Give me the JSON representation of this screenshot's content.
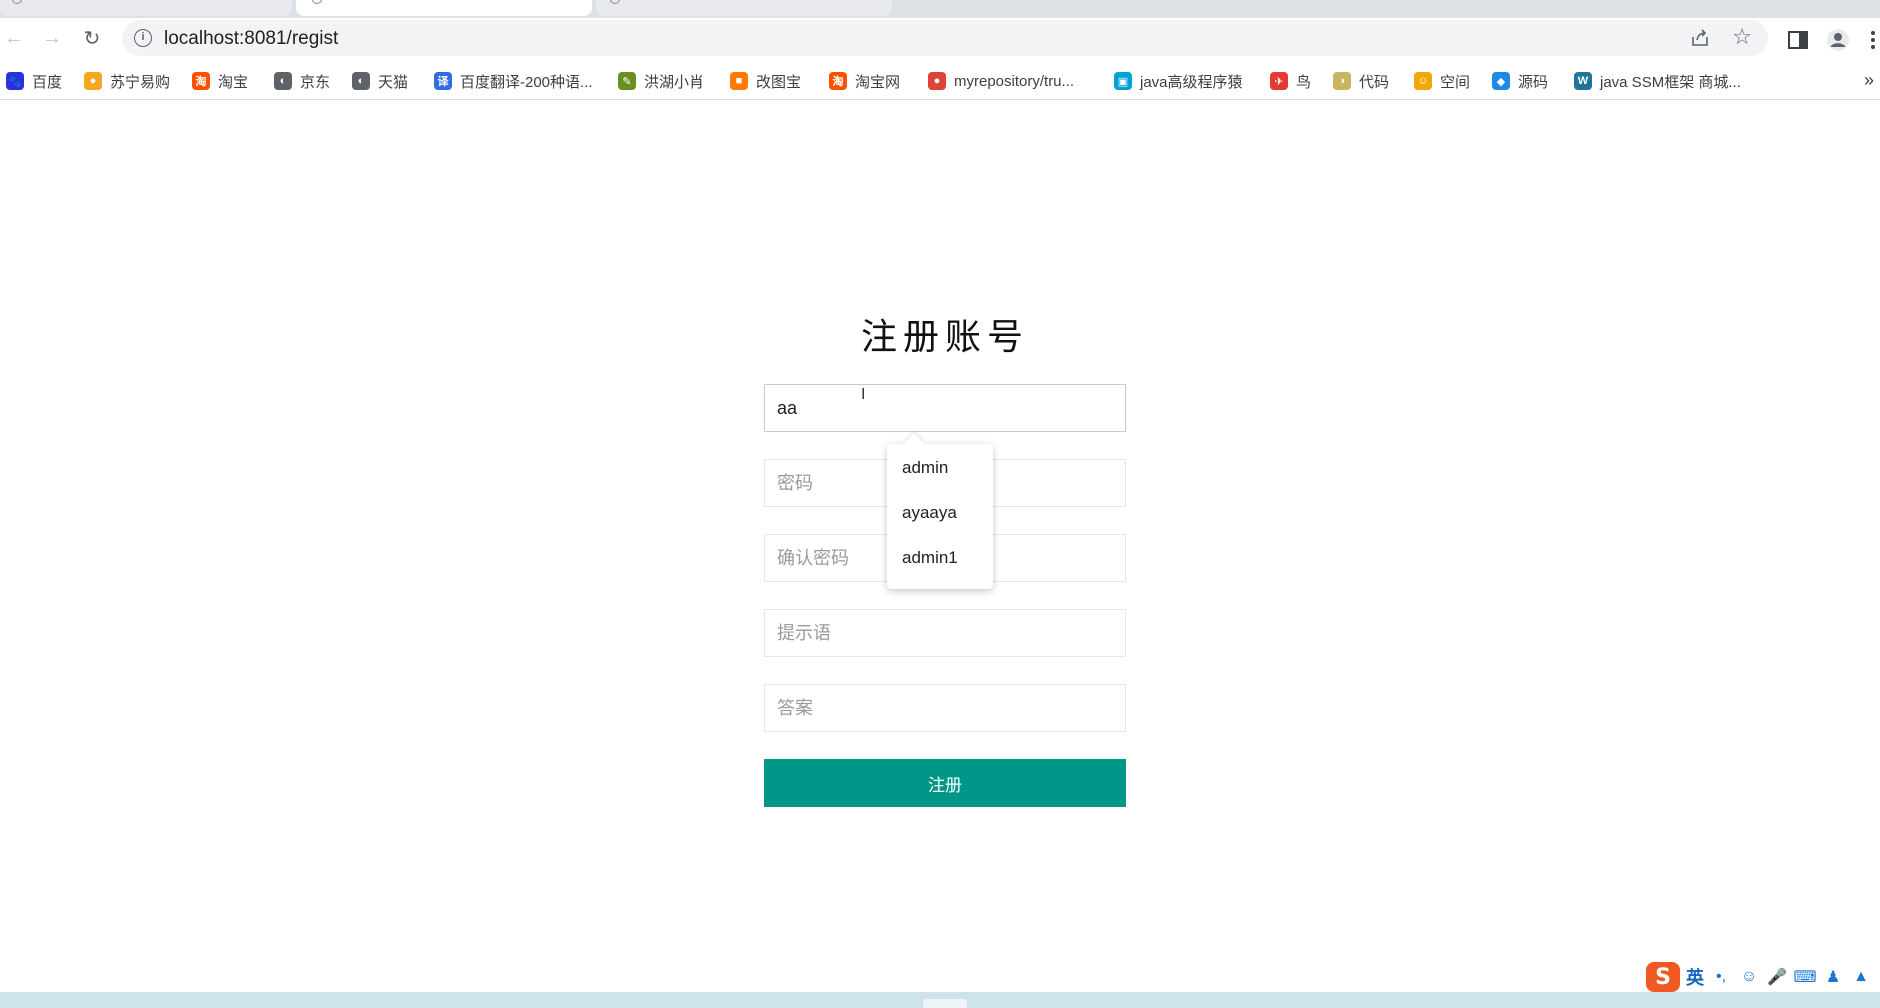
{
  "browser": {
    "url": "localhost:8081/regist",
    "info_icon": "i"
  },
  "bookmarks": [
    {
      "label": "百度",
      "icon": "baidu-icon",
      "color": "#2932e1",
      "glyph": "🐾"
    },
    {
      "label": "苏宁易购",
      "icon": "suning-icon",
      "color": "#f5a623",
      "glyph": "●"
    },
    {
      "label": "淘宝",
      "icon": "taobao-icon",
      "color": "#ff5000",
      "glyph": "淘"
    },
    {
      "label": "京东",
      "icon": "globe-icon",
      "color": "#5f6368",
      "glyph": "◐"
    },
    {
      "label": "天猫",
      "icon": "globe-icon",
      "color": "#5f6368",
      "glyph": "◐"
    },
    {
      "label": "百度翻译-200种语...",
      "icon": "translate-icon",
      "color": "#2f6de1",
      "glyph": "译"
    },
    {
      "label": "洪湖小肖",
      "icon": "hunter-icon",
      "color": "#6b8e23",
      "glyph": "✎"
    },
    {
      "label": "改图宝",
      "icon": "gaitubao-icon",
      "color": "#ff7a00",
      "glyph": "■"
    },
    {
      "label": "淘宝网",
      "icon": "taobao-icon",
      "color": "#ff5000",
      "glyph": "淘"
    },
    {
      "label": "myrepository/tru...",
      "icon": "chrome-icon",
      "color": "#db4437",
      "glyph": "●"
    },
    {
      "label": "java高级程序猿",
      "icon": "bilibili-icon",
      "color": "#00a1d6",
      "glyph": "▣"
    },
    {
      "label": "鸟",
      "icon": "bird-icon",
      "color": "#e53935",
      "glyph": "✈"
    },
    {
      "label": "代码",
      "icon": "code-icon",
      "color": "#c8b560",
      "glyph": "◑"
    },
    {
      "label": "空间",
      "icon": "qzone-icon",
      "color": "#f4a600",
      "glyph": "☺"
    },
    {
      "label": "源码",
      "icon": "fish-icon",
      "color": "#1e88e5",
      "glyph": "◆"
    },
    {
      "label": "java SSM框架 商城...",
      "icon": "wordpress-icon",
      "color": "#21759b",
      "glyph": "W"
    }
  ],
  "form": {
    "title": "注册账号",
    "username_value": "aa",
    "password_placeholder": "密码",
    "confirm_placeholder": "确认密码",
    "hint_placeholder": "提示语",
    "answer_placeholder": "答案",
    "submit_label": "注册"
  },
  "autocomplete": {
    "options": [
      "admin",
      "ayaaya",
      "admin1"
    ]
  },
  "ime": {
    "logo": "S",
    "mode": "英",
    "punct": "•,"
  },
  "colors": {
    "primary": "#009688",
    "chrome_bg": "#dee1e6"
  }
}
